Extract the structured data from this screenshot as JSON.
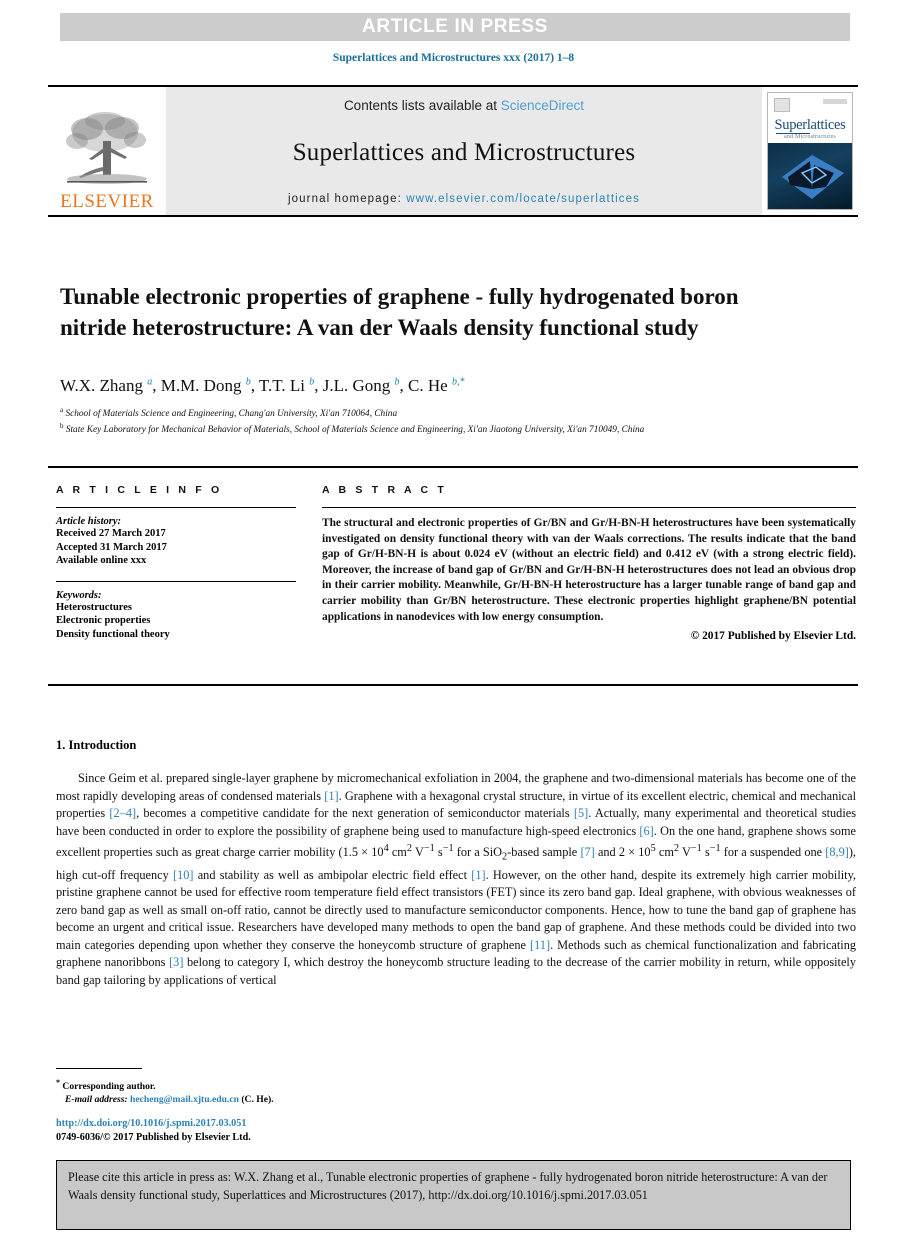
{
  "banner": {
    "text": "ARTICLE IN PRESS"
  },
  "journal_ref": "Superlattices and Microstructures xxx (2017) 1–8",
  "masthead": {
    "publisher": "ELSEVIER",
    "contents_prefix": "Contents lists available at ",
    "contents_link": "ScienceDirect",
    "journal_title": "Superlattices and Microstructures",
    "homepage_prefix": "journal homepage: ",
    "homepage_url": "www.elsevier.com/locate/superlattices",
    "cover": {
      "title": "Superlattices",
      "subtitle": "and Microstructures"
    }
  },
  "article": {
    "title": "Tunable electronic properties of graphene - fully hydrogenated boron nitride heterostructure: A van der Waals density functional study",
    "authors": "W.X. Zhang a, M.M. Dong b, T.T. Li b, J.L. Gong b, C. He b,*",
    "affiliation_a": "School of Materials Science and Engineering, Chang'an University, Xi'an 710064, China",
    "affiliation_b": "State Key Laboratory for Mechanical Behavior of Materials, School of Materials Science and Engineering, Xi'an Jiaotong University, Xi'an 710049, China"
  },
  "article_info": {
    "heading": "A R T I C L E  I N F O",
    "history_label": "Article history:",
    "history": [
      "Received 27 March 2017",
      "Accepted 31 March 2017",
      "Available online xxx"
    ],
    "keywords_label": "Keywords:",
    "keywords": [
      "Heterostructures",
      "Electronic properties",
      "Density functional theory"
    ]
  },
  "abstract": {
    "heading": "A B S T R A C T",
    "body": "The structural and electronic properties of Gr/BN and Gr/H-BN-H heterostructures have been systematically investigated on density functional theory with van der Waals corrections. The results indicate that the band gap of Gr/H-BN-H is about 0.024 eV (without an electric field) and 0.412 eV (with a strong electric field). Moreover, the increase of band gap of Gr/BN and Gr/H-BN-H heterostructures does not lead an obvious drop in their carrier mobility. Meanwhile, Gr/H-BN-H heterostructure has a larger tunable range of band gap and carrier mobility than Gr/BN heterostructure. These electronic properties highlight graphene/BN potential applications in nanodevices with low energy consumption.",
    "copyright": "© 2017 Published by Elsevier Ltd."
  },
  "introduction": {
    "heading": "1. Introduction"
  },
  "footnote": {
    "corresponding": "Corresponding author.",
    "email_label": "E-mail address:",
    "email": "hecheng@mail.xjtu.edu.cn",
    "email_suffix": " (C. He).",
    "doi": "http://dx.doi.org/10.1016/j.spmi.2017.03.051",
    "issn_line": "0749-6036/© 2017 Published by Elsevier Ltd."
  },
  "cite_box": {
    "text": "Please cite this article in press as: W.X. Zhang et al., Tunable electronic properties of graphene - fully hydrogenated boron nitride heterostructure: A van der Waals density functional study, Superlattices and Microstructures (2017), http://dx.doi.org/10.1016/j.spmi.2017.03.051"
  },
  "colors": {
    "accent_link": "#2d82b5",
    "science_direct": "#4d9fd3",
    "elsevier_orange": "#E87722",
    "banner_gray": "#cccccc",
    "cite_gray": "#c8c8c8"
  }
}
